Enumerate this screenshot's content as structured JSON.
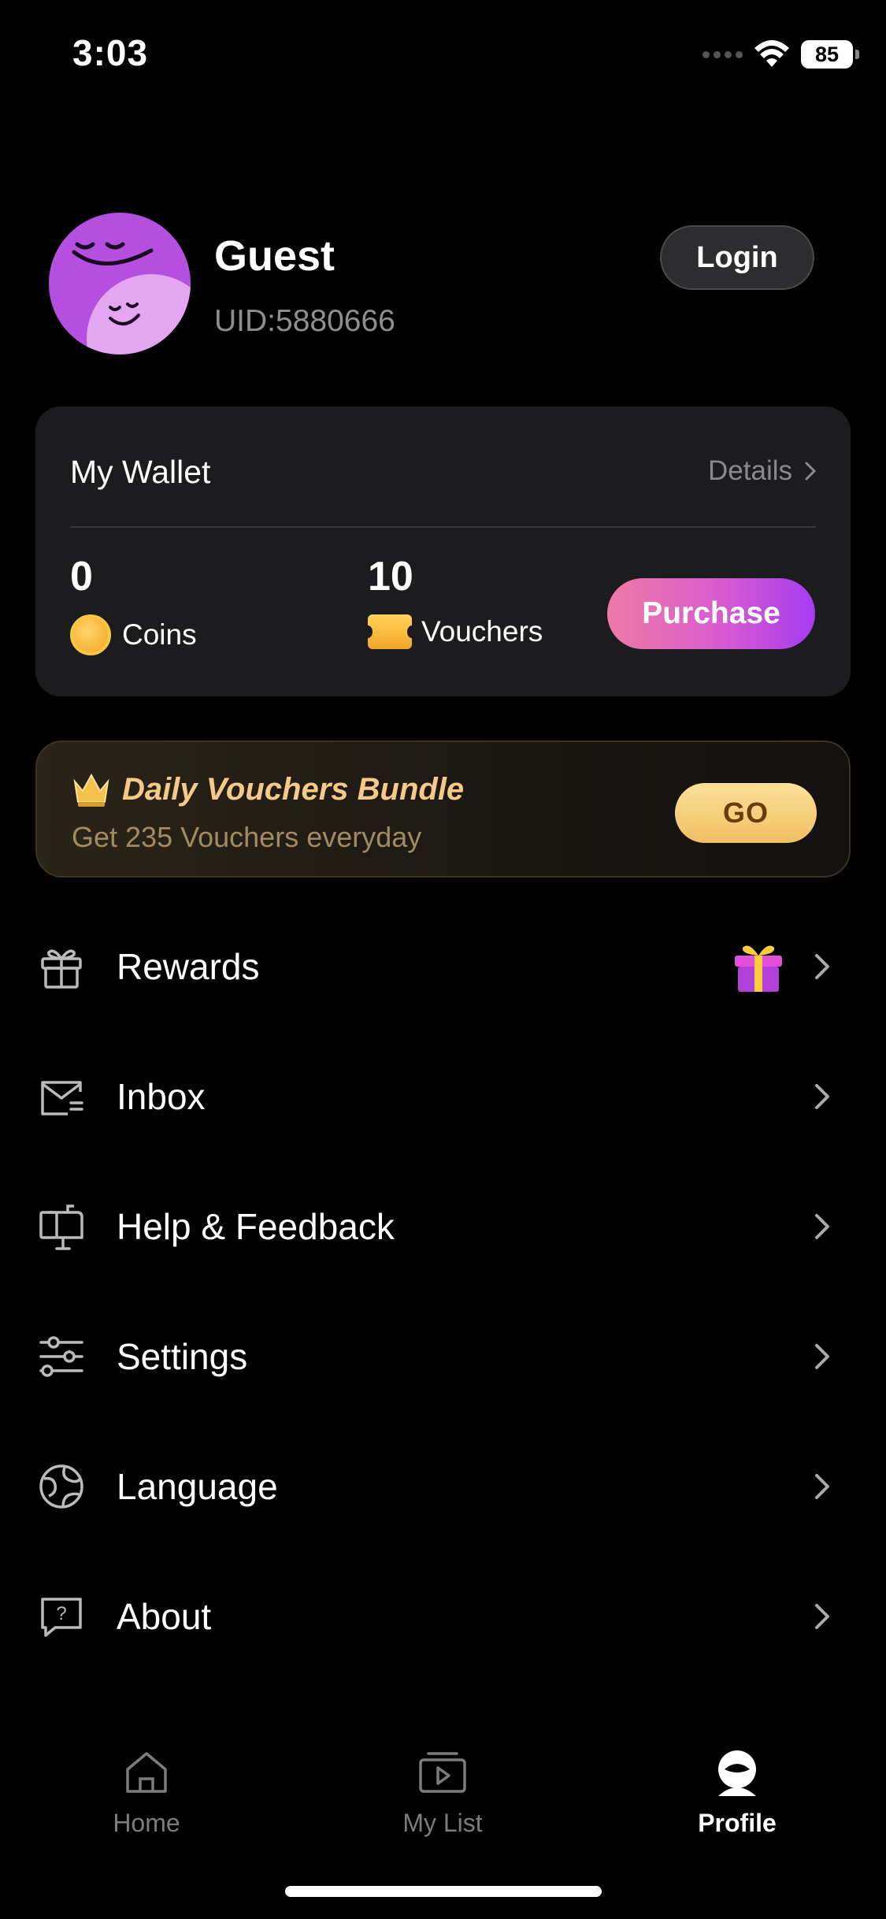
{
  "status_bar": {
    "time": "3:03",
    "battery": "85"
  },
  "profile": {
    "name": "Guest",
    "uid": "UID:5880666",
    "login_label": "Login"
  },
  "wallet": {
    "title": "My Wallet",
    "details_label": "Details",
    "coins_value": "0",
    "coins_label": "Coins",
    "vouchers_value": "10",
    "vouchers_label": "Vouchers",
    "purchase_label": "Purchase"
  },
  "bundle": {
    "title": "Daily Vouchers Bundle",
    "subtitle": "Get 235 Vouchers everyday",
    "go_label": "GO"
  },
  "menu": [
    {
      "label": "Rewards",
      "icon": "gift-icon"
    },
    {
      "label": "Inbox",
      "icon": "mail-icon"
    },
    {
      "label": "Help & Feedback",
      "icon": "mailbox-icon"
    },
    {
      "label": "Settings",
      "icon": "sliders-icon"
    },
    {
      "label": "Language",
      "icon": "globe-icon"
    },
    {
      "label": "About",
      "icon": "question-bubble-icon"
    }
  ],
  "tabs": [
    {
      "label": "Home",
      "icon": "home-icon",
      "active": false
    },
    {
      "label": "My List",
      "icon": "play-list-icon",
      "active": false
    },
    {
      "label": "Profile",
      "icon": "profile-icon",
      "active": true
    }
  ],
  "colors": {
    "accent_start": "#ee7aa6",
    "accent_end": "#a53cf0",
    "gold": "#f5c98a"
  }
}
